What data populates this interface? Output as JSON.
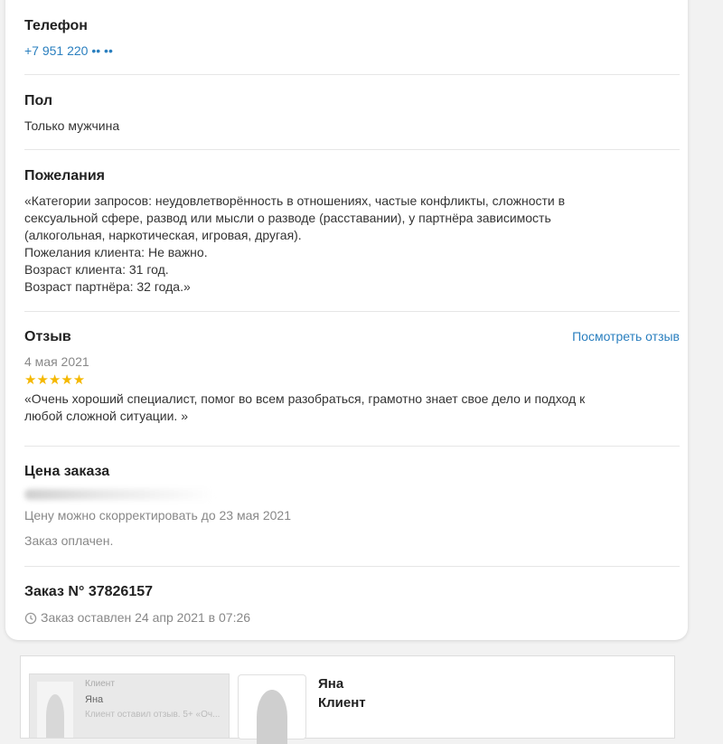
{
  "phone": {
    "heading": "Телефон",
    "value": "+7 951 220 •• ••"
  },
  "gender": {
    "heading": "Пол",
    "value": "Только мужчина"
  },
  "wishes": {
    "heading": "Пожелания",
    "lines": [
      "«Категории запросов: неудовлетворённость в отношениях, частые конфликты, сложности в",
      "сексуальной сфере, развод или мысли о разводе (расставании), у партнёра зависимость",
      "(алкогольная, наркотическая, игровая, другая).",
      "Пожелания клиента: Не важно.",
      "Возраст клиента: 31 год.",
      "Возраст партнёра: 32 года.»"
    ]
  },
  "review": {
    "heading": "Отзыв",
    "view_link": "Посмотреть отзыв",
    "date": "4 мая 2021",
    "rating": 5,
    "rating_max": 5,
    "stars": "★★★★★",
    "text_lines": [
      "«Очень хороший специалист, помог во всем разобраться, грамотно знает свое дело и подход к",
      "любой сложной ситуации. »"
    ]
  },
  "price": {
    "heading": "Цена заказа",
    "note": "Цену можно скорректировать до 23 мая 2021",
    "status": "Заказ оплачен."
  },
  "order": {
    "heading": "Заказ N° 37826157",
    "clock_icon": "clock-icon",
    "placed": "Заказ оставлен 24 апр 2021 в 07:26"
  },
  "client_panel": {
    "thumb_role": "Клиент",
    "thumb_name": "Яна",
    "thumb_text": "Клиент оставил отзыв. 5+ «Оч...",
    "name": "Яна",
    "role": "Клиент"
  }
}
